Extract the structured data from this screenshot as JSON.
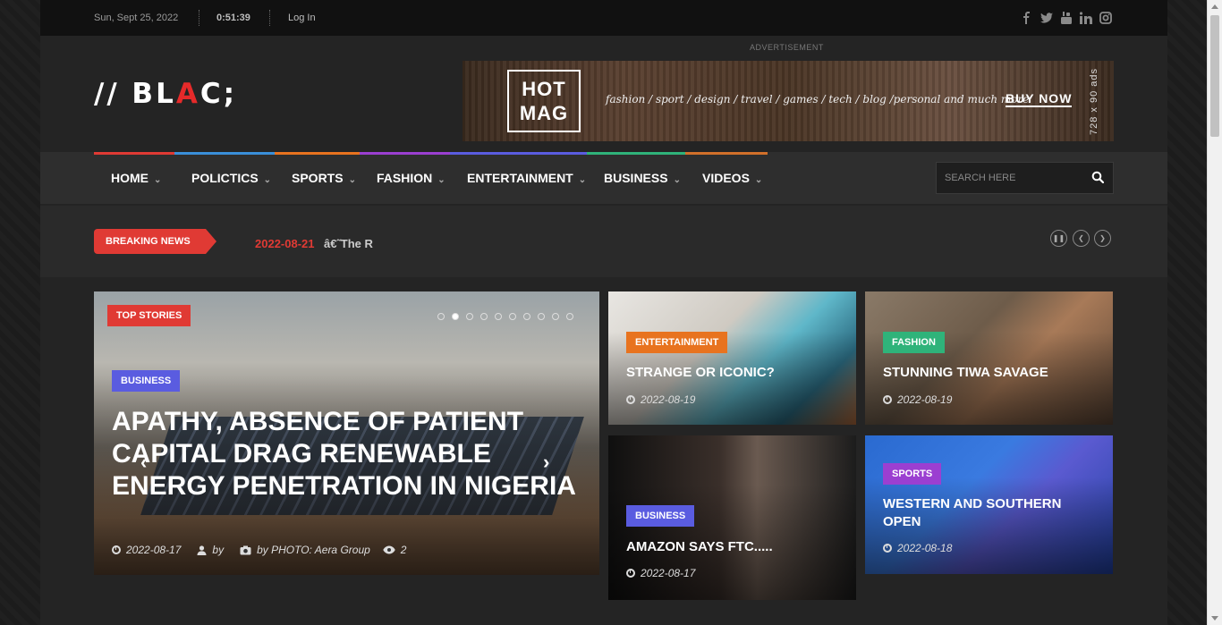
{
  "topbar": {
    "date": "Sun, Sept 25, 2022",
    "time": "0:51:39",
    "login": "Log In",
    "social_icons": [
      "facebook-icon",
      "twitter-icon",
      "youtube-icon",
      "linkedin-icon",
      "instagram-icon"
    ]
  },
  "header": {
    "logo_prefix": "// BL",
    "logo_red": "A",
    "logo_suffix": "C;",
    "ad_label": "ADVERTISEMENT",
    "ad": {
      "brand_line1": "HOT",
      "brand_line2": "MAG",
      "tagline": "fashion / sport / design / travel / games / tech / blog /personal and much more",
      "cta": "BUY NOW",
      "size": "728 x 90 ads"
    }
  },
  "nav": {
    "items": [
      {
        "label": "HOME",
        "color": "#e03a34"
      },
      {
        "label": "POLICTICS",
        "color": "#3a8fd9"
      },
      {
        "label": "SPORTS",
        "color": "#e8731f"
      },
      {
        "label": "FASHION",
        "color": "#9b3fd1"
      },
      {
        "label": "ENTERTAINMENT",
        "color": "#5a5ce0"
      },
      {
        "label": "BUSINESS",
        "color": "#2fb37a"
      },
      {
        "label": "VIDEOS",
        "color": "#d2702a"
      }
    ],
    "search_placeholder": "SEARCH HERE"
  },
  "breaking": {
    "label": "BREAKING NEWS",
    "date": "2022-08-21",
    "text": "â€˜The R"
  },
  "featured": {
    "badge": "TOP STORIES",
    "category": "BUSINESS",
    "title": "APATHY, ABSENCE OF PATIENT CAPITAL DRAG RENEWABLE ENERGY PENETRATION IN NIGERIA",
    "date": "2022-08-17",
    "by": "by",
    "photo_credit": "by PHOTO: Aera Group",
    "views": "2"
  },
  "cards": [
    {
      "category": "ENTERTAINMENT",
      "cat_color": "#e8731f",
      "title": "STRANGE OR ICONIC?",
      "date": "2022-08-19"
    },
    {
      "category": "FASHION",
      "cat_color": "#2fb37a",
      "title": "STUNNING TIWA SAVAGE",
      "date": "2022-08-19"
    },
    {
      "category": "BUSINESS",
      "cat_color": "#5a5ce0",
      "title": "AMAZON SAYS FTC.....",
      "date": "2022-08-17"
    },
    {
      "category": "SPORTS",
      "cat_color": "#9b3fd1",
      "title": "WESTERN AND SOUTHERN OPEN",
      "date": "2022-08-18"
    }
  ]
}
